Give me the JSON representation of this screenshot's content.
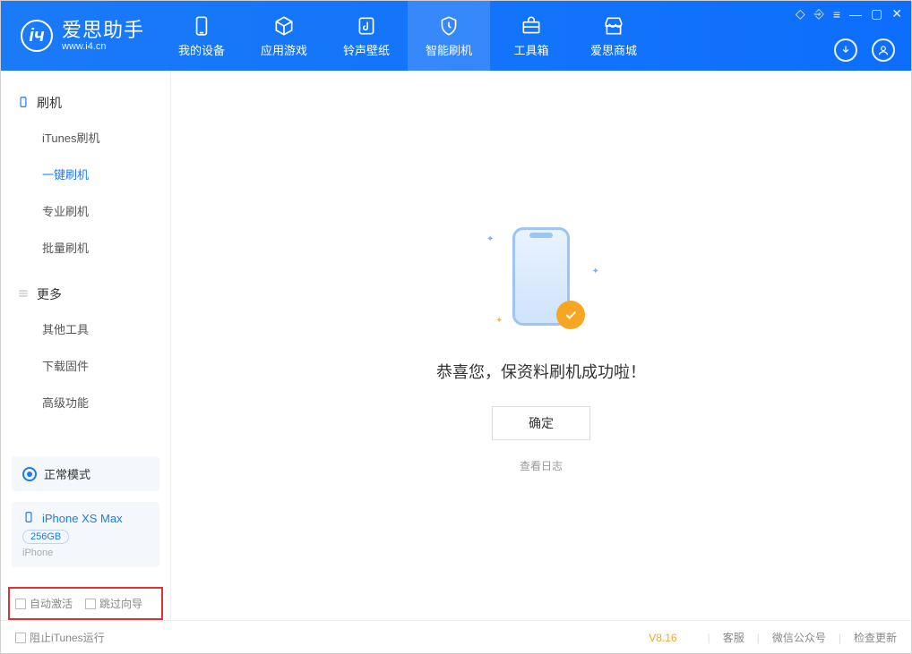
{
  "app": {
    "title": "爱思助手",
    "subtitle": "www.i4.cn"
  },
  "nav": {
    "device": "我的设备",
    "apps": "应用游戏",
    "ring": "铃声壁纸",
    "flash": "智能刷机",
    "toolbox": "工具箱",
    "store": "爱思商城"
  },
  "sidebar": {
    "group1": "刷机",
    "items1": [
      "iTunes刷机",
      "一键刷机",
      "专业刷机",
      "批量刷机"
    ],
    "group2": "更多",
    "items2": [
      "其他工具",
      "下载固件",
      "高级功能"
    ],
    "mode": "正常模式",
    "device": {
      "name": "iPhone XS Max",
      "storage": "256GB",
      "type": "iPhone"
    },
    "checks": {
      "auto": "自动激活",
      "skip": "跳过向导"
    }
  },
  "main": {
    "success": "恭喜您，保资料刷机成功啦！",
    "ok": "确定",
    "log": "查看日志"
  },
  "footer": {
    "block_itunes": "阻止iTunes运行",
    "version": "V8.16",
    "support": "客服",
    "wechat": "微信公众号",
    "update": "检查更新"
  }
}
